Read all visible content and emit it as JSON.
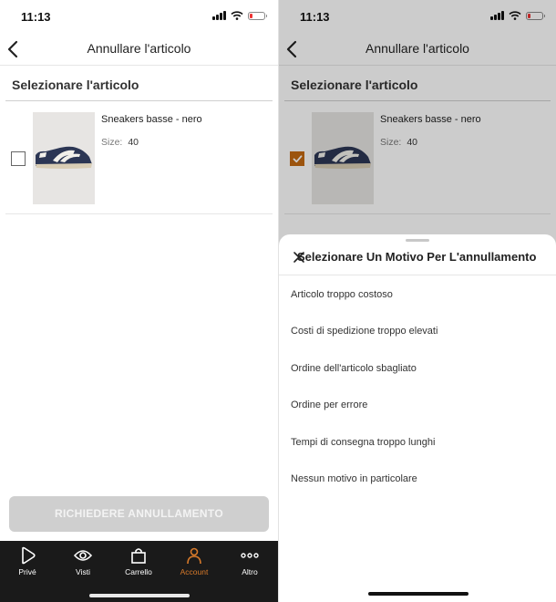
{
  "status": {
    "time": "11:13"
  },
  "nav": {
    "title": "Annullare l'articolo"
  },
  "section": {
    "title": "Selezionare l'articolo"
  },
  "item": {
    "name": "Sneakers basse - nero",
    "size_label": "Size:",
    "size_value": "40"
  },
  "left": {
    "checkbox_checked": false,
    "cta_label": "RICHIEDERE ANNULLAMENTO"
  },
  "right": {
    "checkbox_checked": true
  },
  "tabs": [
    {
      "label": "Privé",
      "icon": "play-icon",
      "active": false
    },
    {
      "label": "Visti",
      "icon": "eye-icon",
      "active": false
    },
    {
      "label": "Carrello",
      "icon": "bag-icon",
      "active": false
    },
    {
      "label": "Account",
      "icon": "person-icon",
      "active": true
    },
    {
      "label": "Altro",
      "icon": "more-icon",
      "active": false
    }
  ],
  "sheet": {
    "title": "Selezionare Un Motivo Per L'annullamento",
    "reasons": [
      "Articolo troppo costoso",
      "Costi di spedizione troppo elevati",
      "Ordine dell'articolo sbagliato",
      "Ordine per errore",
      "Tempi di consegna troppo lunghi",
      "Nessun motivo in particolare"
    ]
  },
  "colors": {
    "accent": "#c46a12",
    "tab_active": "#d87a2a",
    "tabbar_bg": "#1a1a1a",
    "cta_disabled": "#cfcfcf"
  }
}
